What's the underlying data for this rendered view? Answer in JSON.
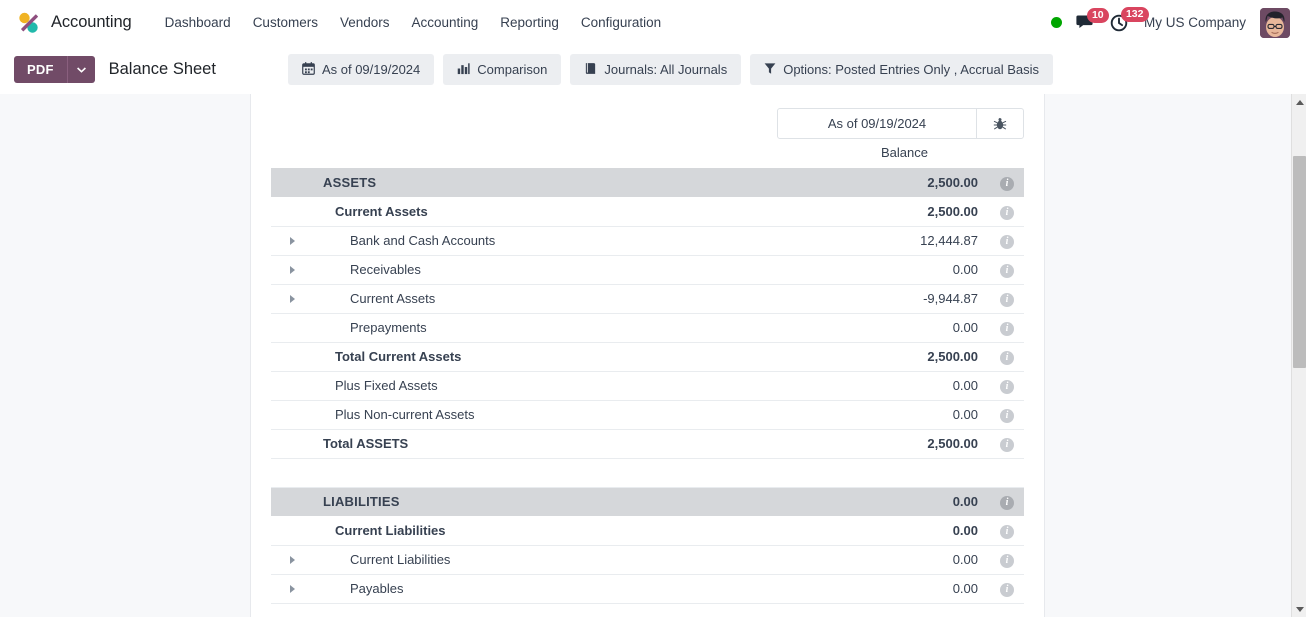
{
  "navbar": {
    "brand": "Accounting",
    "logo_icon": "odoo-logo-icon",
    "menu": [
      {
        "label": "Dashboard"
      },
      {
        "label": "Customers"
      },
      {
        "label": "Vendors"
      },
      {
        "label": "Accounting"
      },
      {
        "label": "Reporting"
      },
      {
        "label": "Configuration"
      }
    ],
    "status_indicator": "online-status-dot",
    "messages": {
      "icon": "chat-icon",
      "count": "10"
    },
    "activities": {
      "icon": "clock-icon",
      "count": "132"
    },
    "company": "My US Company",
    "avatar_icon": "user-avatar"
  },
  "toolbar": {
    "pdf_label": "PDF",
    "pdf_caret_icon": "chevron-down-icon",
    "report_title": "Balance Sheet",
    "filters": [
      {
        "icon": "calendar-icon",
        "glyph": "Ὄ5",
        "label": "As of 09/19/2024",
        "name": "date-filter"
      },
      {
        "icon": "bar-chart-icon",
        "glyph": "▌",
        "label": "Comparison",
        "name": "comparison-filter"
      },
      {
        "icon": "book-icon",
        "glyph": "Ὅ5",
        "label": "Journals: All Journals",
        "name": "journals-filter"
      },
      {
        "icon": "funnel-icon",
        "glyph": "▼",
        "label": "Options: Posted Entries Only , Accrual Basis",
        "name": "options-filter"
      }
    ]
  },
  "report": {
    "date_column_label": "As of 09/19/2024",
    "bug_icon": "bug-icon",
    "balance_header": "Balance",
    "info_icon": "info-icon",
    "expand_icon": "caret-right-icon",
    "rows": [
      {
        "label": "ASSETS",
        "value": "2,500.00",
        "level": "lvl-head",
        "expandable": false,
        "state": "normal"
      },
      {
        "label": "Current Assets",
        "value": "2,500.00",
        "level": "lvl-sub",
        "expandable": false,
        "state": "normal"
      },
      {
        "label": "Bank and Cash Accounts",
        "value": "12,444.87",
        "level": "lvl-leaf",
        "expandable": true,
        "state": "normal"
      },
      {
        "label": "Receivables",
        "value": "0.00",
        "level": "lvl-leaf",
        "expandable": true,
        "state": "zero"
      },
      {
        "label": "Current Assets",
        "value": "-9,944.87",
        "level": "lvl-leaf",
        "expandable": true,
        "state": "negative"
      },
      {
        "label": "Prepayments",
        "value": "0.00",
        "level": "lvl-leaf",
        "expandable": false,
        "state": "zero"
      },
      {
        "label": "Total Current Assets",
        "value": "2,500.00",
        "level": "lvl-total",
        "expandable": false,
        "state": "normal"
      },
      {
        "label": "Plus Fixed Assets",
        "value": "0.00",
        "level": "lvl-plus",
        "expandable": false,
        "state": "zero"
      },
      {
        "label": "Plus Non-current Assets",
        "value": "0.00",
        "level": "lvl-plus",
        "expandable": false,
        "state": "zero"
      },
      {
        "label": "Total ASSETS",
        "value": "2,500.00",
        "level": "lvl-grand",
        "expandable": false,
        "state": "normal"
      },
      {
        "label": "",
        "value": "",
        "level": "spacer",
        "expandable": false,
        "state": "spacer"
      },
      {
        "label": "LIABILITIES",
        "value": "0.00",
        "level": "lvl-head",
        "expandable": false,
        "state": "zero"
      },
      {
        "label": "Current Liabilities",
        "value": "0.00",
        "level": "lvl-sub",
        "expandable": false,
        "state": "zero"
      },
      {
        "label": "Current Liabilities",
        "value": "0.00",
        "level": "lvl-leaf",
        "expandable": true,
        "state": "zero"
      },
      {
        "label": "Payables",
        "value": "0.00",
        "level": "lvl-leaf",
        "expandable": true,
        "state": "zero"
      }
    ]
  },
  "scrollbar": {
    "up_icon": "triangle-up-icon",
    "down_icon": "triangle-down-icon"
  },
  "colors": {
    "brand_purple": "#714B67",
    "negative_red": "#d9342b",
    "badge_red": "#d9455f",
    "online_green": "#00a600",
    "header_gray": "#d5d7da"
  }
}
